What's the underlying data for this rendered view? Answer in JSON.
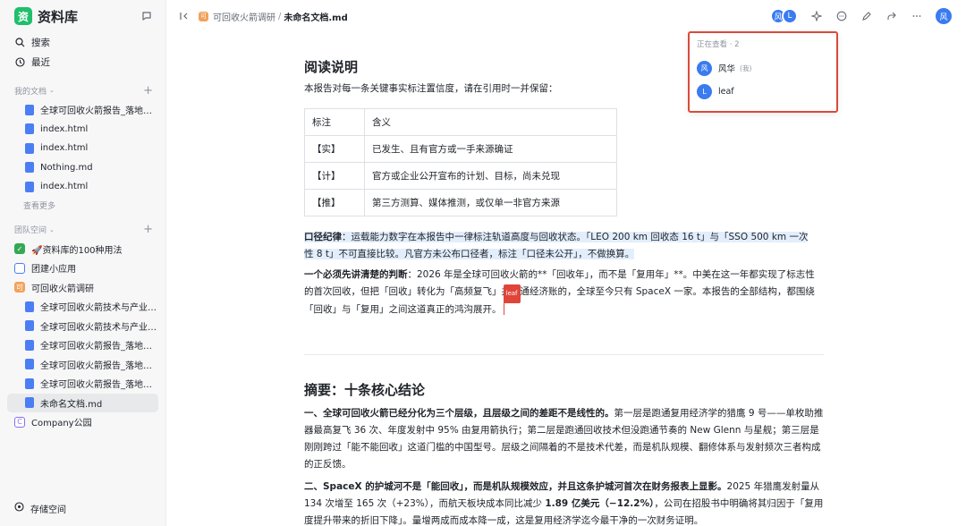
{
  "app": {
    "name": "资料库",
    "logo_text": "资"
  },
  "sidebar": {
    "search_label": "搜索",
    "recent_label": "最近",
    "my_docs_label": "我的文档",
    "my_docs": [
      "全球可回收火箭报告_落地页....",
      "index.html",
      "index.html",
      "Nothing.md",
      "index.html"
    ],
    "see_more": "查看更多",
    "team_label": "团队空间",
    "spaces": {
      "s1": "🚀资料库的100种用法",
      "s2": "团建小应用",
      "s3": "可回收火箭调研",
      "sub": [
        "全球可回收火箭技术与产业深...",
        "全球可回收火箭技术与产业深...",
        "全球可回收火箭报告_落地页....",
        "全球可回收火箭报告_落地页....",
        "全球可回收火箭报告_落地页....",
        "未命名文档.md"
      ],
      "s4": "Company公园",
      "s4_icon": "C"
    },
    "storage_label": "存储空间"
  },
  "topbar": {
    "crumb_icon": "可",
    "crumb_parent": "可回收火箭调研",
    "separator": "/",
    "crumb_current": "未命名文档.md",
    "avatars": [
      "风",
      "L"
    ],
    "me_avatar": "风"
  },
  "viewers": {
    "title": "正在查看 · 2",
    "list": [
      {
        "avatar": "风",
        "name": "风华",
        "tag": "(我)"
      },
      {
        "avatar": "L",
        "name": "leaf",
        "tag": ""
      }
    ]
  },
  "doc": {
    "heading1": "阅读说明",
    "intro": "本报告对每一条关键事实标注置信度，请在引用时一并保留：",
    "table": {
      "headers": [
        "标注",
        "含义"
      ],
      "rows": [
        [
          "【实】",
          "已发生、且有官方或一手来源确证"
        ],
        [
          "【计】",
          "官方或企业公开宣布的计划、目标，尚未兑现"
        ],
        [
          "【推】",
          "第三方测算、媒体推测，或仅单一非官方来源"
        ]
      ]
    },
    "caliber_label": "口径纪律",
    "caliber_line1": "：运载能力数字在本报告中一律标注轨道高度与回收状态。「LEO 200 km 回收态 16 t」与「SSO 500 km 一次",
    "caliber_line2": "性 8 t」不可直接比较。凡官方未公布口径者，标注「口径未公开」，不做换算。",
    "key_label": "一个必须先讲清楚的判断",
    "key_text_1": "：2026 年是全球可回收火箭的**「回收年」，而不是「复用年」**。中美在这一年都实现了标志性的首次回收，但把「回收」转化为「高频复飞」并跑通经济账的，全球至今只有 SpaceX 一家。本报告的全部结构，都围绕「回收」与「复用」之间这道真正的鸿沟展开。",
    "cursor_user": "leaf",
    "heading2": "摘要：十条核心结论",
    "p1_bold": "一、全球可回收火箭已经分化为三个层级，且层级之间的差距不是线性的。",
    "p1_text": "第一层是跑通复用经济学的猎鹰 9 号——单枚助推器最高复飞 36 次、年度发射中 95% 由复用箭执行；第二层是跑通回收技术但没跑通节奏的 New Glenn 与星舰；第三层是刚刚跨过「能不能回收」这道门槛的中国型号。层级之间隔着的不是技术代差，而是机队规模、翻修体系与发射频次三者构成的正反馈。",
    "p2_bold": "二、SpaceX 的护城河不是「能回收」，而是机队规模效应，并且这条护城河首次在财务报表上显影。",
    "p2_text_a": "2025 年猎鹰发射量从 134 次增至 165 次（+23%），而航天板块成本同比减少 ",
    "p2_num": "1.89 亿美元（−12.2%）",
    "p2_text_b": "，公司在招股书中明确将其归因于「复用度提升带来的折旧下降」。量增两成而成本降一成，这是复用经济学迄今最干净的一次财务证明。"
  }
}
